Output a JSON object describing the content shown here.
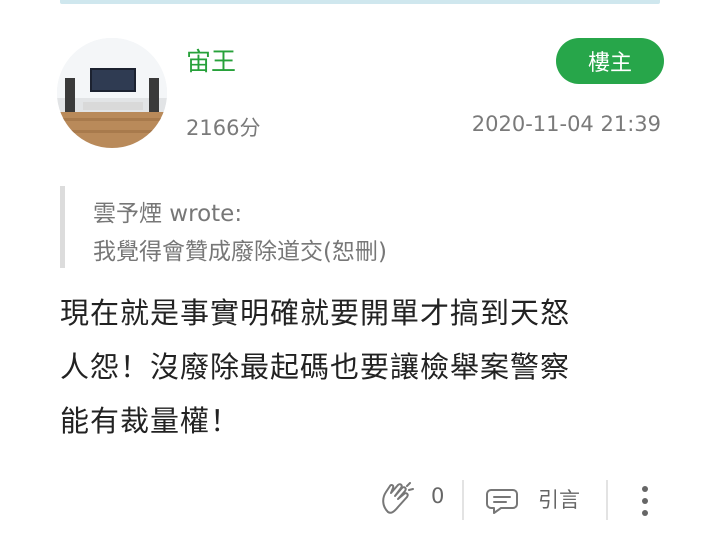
{
  "post": {
    "username": "宙王",
    "score": "2166分",
    "badge": "樓主",
    "timestamp": "2020-11-04 21:39",
    "quote": {
      "author": "雲予煙 wrote:",
      "text": "我覺得會贊成廢除道交(恕刪)"
    },
    "body_lines": [
      "現在就是事實明確就要開單才搞到天怒",
      "人怨！沒廢除最起碼也要讓檢舉案警察",
      "能有裁量權！"
    ],
    "actions": {
      "like_count": "0",
      "quote_label": "引言"
    }
  },
  "colors": {
    "accent": "#27a64a",
    "username": "#27a13a",
    "muted": "#7a7a7a"
  },
  "icons": [
    "clap-icon",
    "quote-bubble-icon",
    "more-vertical-icon"
  ]
}
